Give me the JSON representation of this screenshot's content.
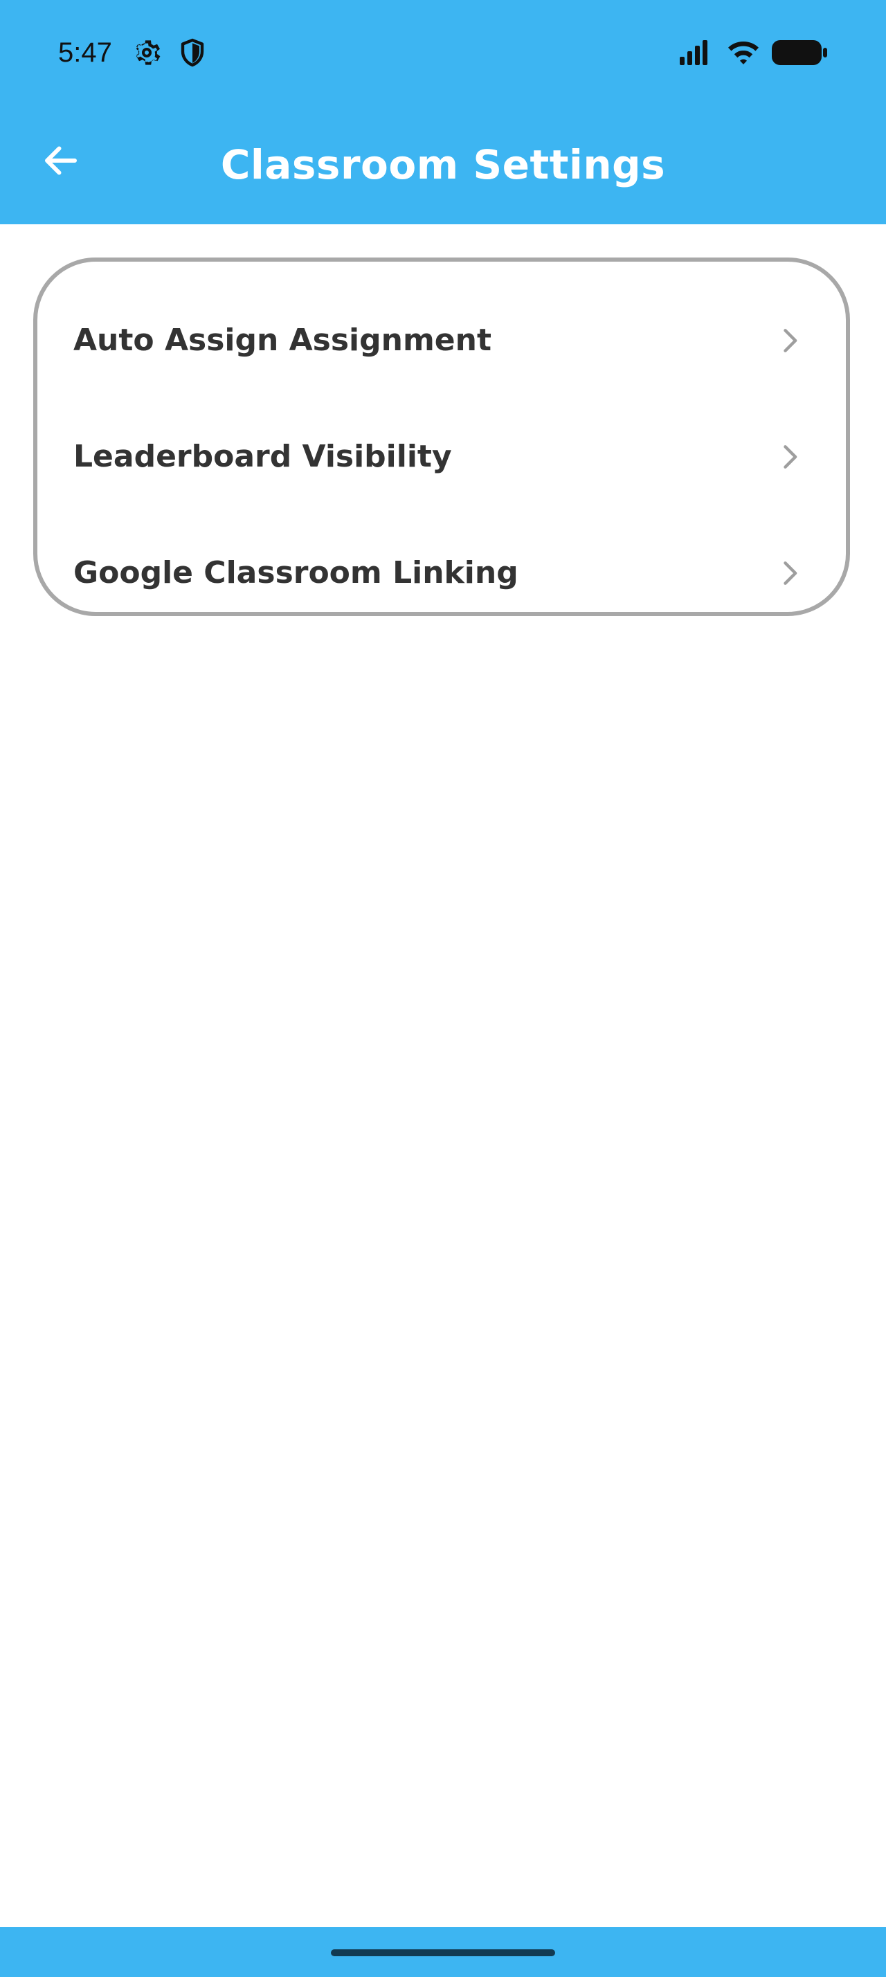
{
  "status_bar": {
    "time": "5:47",
    "icons": [
      "gear-icon",
      "shield-icon",
      "signal-icon",
      "wifi-icon",
      "battery-icon"
    ]
  },
  "app_bar": {
    "title": "Classroom Settings",
    "back_icon": "arrow-left-icon"
  },
  "settings": {
    "items": [
      {
        "label": "Auto Assign Assignment",
        "icon": "chevron-right-icon"
      },
      {
        "label": "Leaderboard Visibility",
        "icon": "chevron-right-icon"
      },
      {
        "label": "Google Classroom Linking",
        "icon": "chevron-right-icon"
      }
    ]
  },
  "colors": {
    "header_background": "#3db5f2",
    "title_text": "#ffffff",
    "item_text": "#333333",
    "card_border": "#a8a8a8",
    "chevron": "#9e9e9e",
    "home_indicator": "#123a52"
  }
}
